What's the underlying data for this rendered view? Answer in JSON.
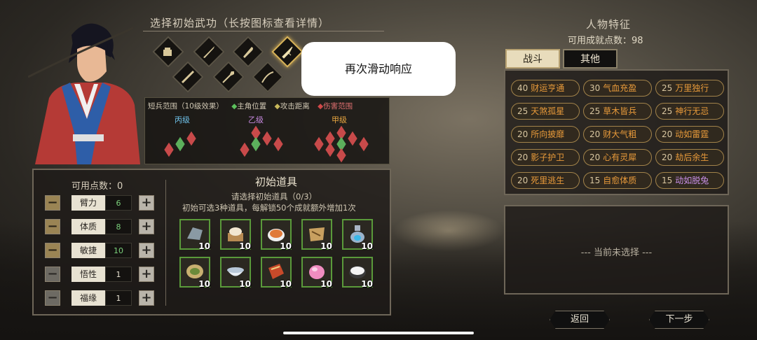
{
  "skills_panel": {
    "title": "选择初始武功（长按图标查看详情）"
  },
  "range_legend": {
    "title": "短兵范围（10级效果）",
    "self_pos": "主角位置",
    "atk_dist": "攻击距离",
    "dmg_range": "伤害范围",
    "levels": [
      "丙级",
      "乙级",
      "甲级"
    ]
  },
  "attributes": {
    "points_label": "可用点数：0",
    "rows": [
      {
        "label": "臂力",
        "value": "6"
      },
      {
        "label": "体质",
        "value": "8"
      },
      {
        "label": "敏捷",
        "value": "10"
      },
      {
        "label": "悟性",
        "value": "1"
      },
      {
        "label": "福缘",
        "value": "1"
      }
    ]
  },
  "items_panel": {
    "title": "初始道具",
    "subtitle": "请选择初始道具（0/3）",
    "hint": "初始可选3种道具，每解锁50个成就额外增加1次",
    "count": "10"
  },
  "traits_panel": {
    "title": "人物特征",
    "points": "可用成就点数：98",
    "tabs": [
      "战斗",
      "其他"
    ],
    "traits": [
      {
        "cost": "40",
        "name": "财运亨通",
        "color": "orange"
      },
      {
        "cost": "30",
        "name": "气血充盈",
        "color": "orange"
      },
      {
        "cost": "25",
        "name": "万里独行",
        "color": "orange"
      },
      {
        "cost": "25",
        "name": "天煞孤星",
        "color": "orange"
      },
      {
        "cost": "25",
        "name": "草木皆兵",
        "color": "orange"
      },
      {
        "cost": "25",
        "name": "神行无忌",
        "color": "orange"
      },
      {
        "cost": "20",
        "name": "所向披靡",
        "color": "orange"
      },
      {
        "cost": "20",
        "name": "财大气粗",
        "color": "orange"
      },
      {
        "cost": "20",
        "name": "动如雷霆",
        "color": "orange"
      },
      {
        "cost": "20",
        "name": "影子护卫",
        "color": "orange"
      },
      {
        "cost": "20",
        "name": "心有灵犀",
        "color": "orange"
      },
      {
        "cost": "20",
        "name": "劫后余生",
        "color": "orange"
      },
      {
        "cost": "20",
        "name": "死里逃生",
        "color": "orange"
      },
      {
        "cost": "15",
        "name": "自愈体质",
        "color": "orange"
      },
      {
        "cost": "15",
        "name": "动如脱兔",
        "color": "purple"
      }
    ],
    "detail_placeholder": "--- 当前未选择 ---"
  },
  "nav": {
    "back": "返回",
    "next": "下一步"
  },
  "toast": "再次滑动响应",
  "colors": {
    "gold": "#d9b45a",
    "orange_text": "#e89a3a",
    "purple_text": "#c990e8",
    "item_border": "#5a9a3a"
  }
}
